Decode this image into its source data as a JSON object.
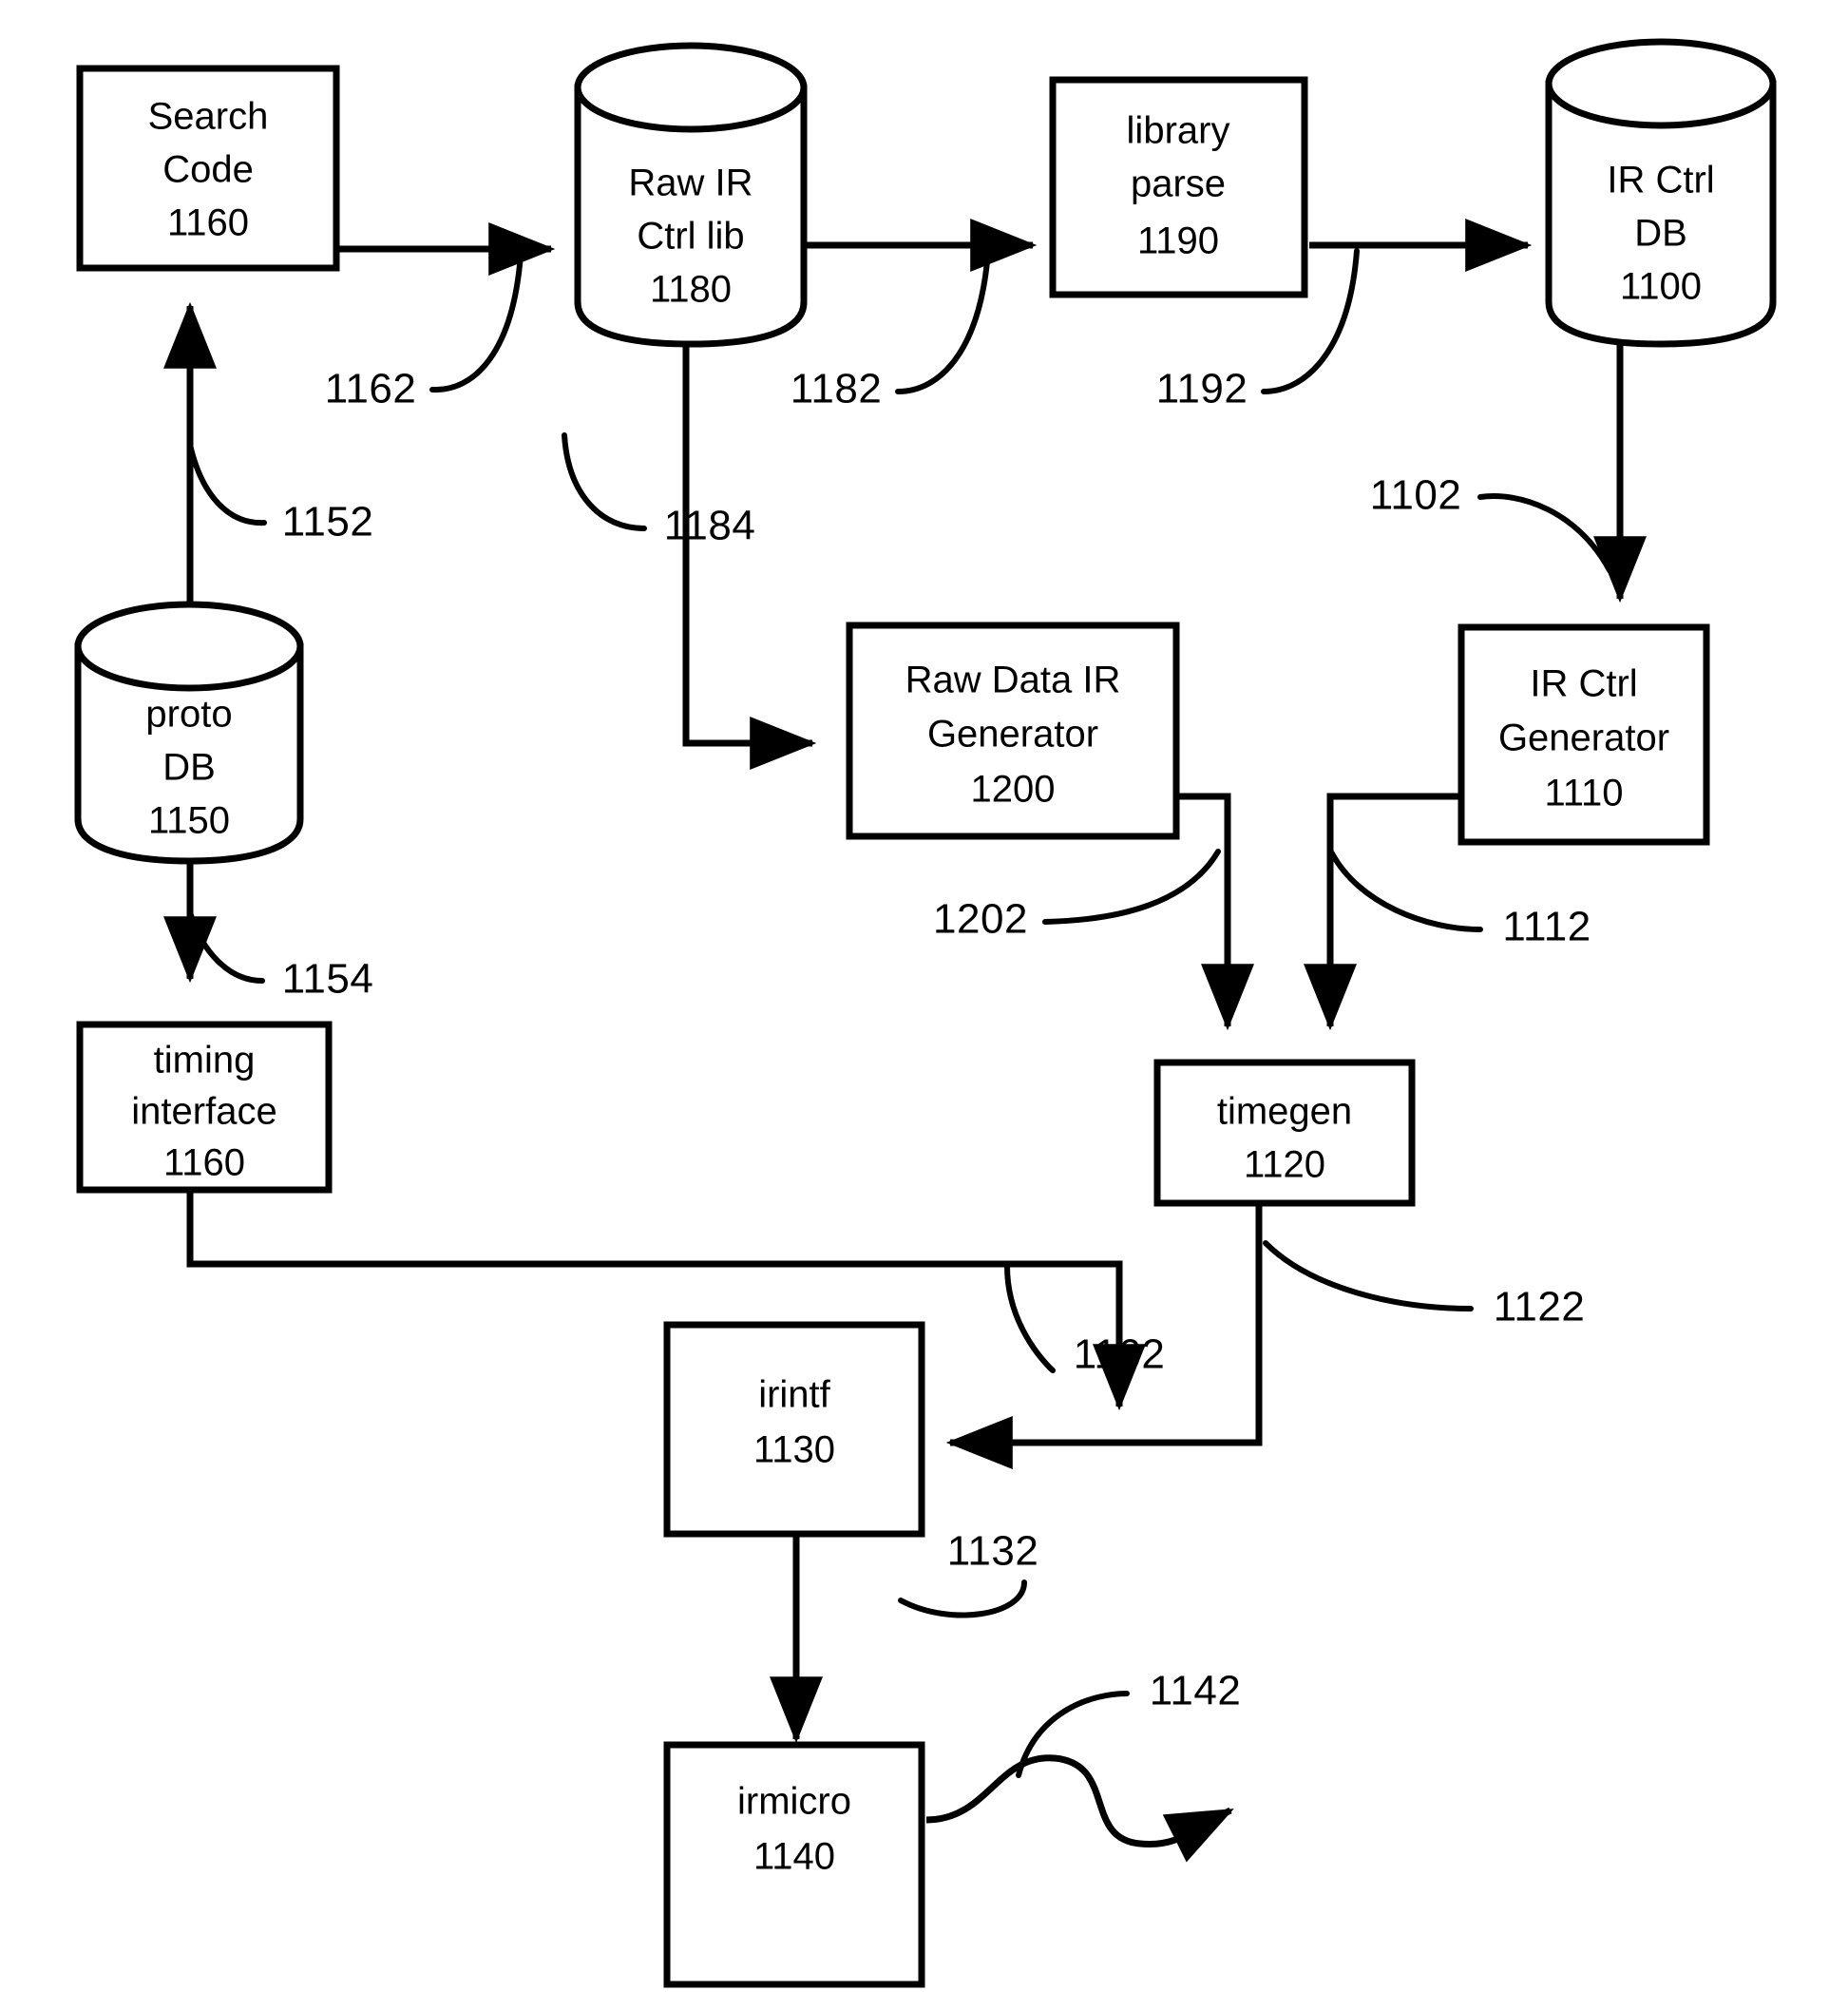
{
  "figure": {
    "type": "patent-flow-diagram",
    "background_color": "#ffffff",
    "line_color": "#000000"
  },
  "nodes": [
    {
      "id": "search_code",
      "shape": "rectangle",
      "lines": [
        "Search",
        "Code",
        "1160"
      ]
    },
    {
      "id": "raw_ir_ctrl_lib",
      "shape": "cylinder",
      "lines": [
        "Raw IR",
        "Ctrl lib",
        "1180"
      ]
    },
    {
      "id": "library_parse",
      "shape": "rectangle",
      "lines": [
        "library",
        "parse",
        "1190"
      ]
    },
    {
      "id": "ir_ctrl_db",
      "shape": "cylinder",
      "lines": [
        "IR Ctrl",
        "DB",
        "1100"
      ]
    },
    {
      "id": "proto_db",
      "shape": "cylinder",
      "lines": [
        "proto",
        "DB",
        "1150"
      ]
    },
    {
      "id": "raw_data_ir_generator",
      "shape": "rectangle",
      "lines": [
        "Raw Data IR",
        "Generator",
        "1200"
      ]
    },
    {
      "id": "ir_ctrl_generator",
      "shape": "rectangle",
      "lines": [
        "IR Ctrl",
        "Generator",
        "1110"
      ]
    },
    {
      "id": "timing_interface",
      "shape": "rectangle",
      "lines": [
        "timing",
        "interface",
        "1160"
      ]
    },
    {
      "id": "timegen",
      "shape": "rectangle",
      "lines": [
        "timegen",
        "1120"
      ]
    },
    {
      "id": "irintf",
      "shape": "rectangle",
      "lines": [
        "irintf",
        "1130"
      ]
    },
    {
      "id": "irmicro",
      "shape": "rectangle",
      "lines": [
        "irmicro",
        "1140"
      ]
    }
  ],
  "reference_labels": [
    {
      "id": "ref_1162_top",
      "text": "1162"
    },
    {
      "id": "ref_1182",
      "text": "1182"
    },
    {
      "id": "ref_1192",
      "text": "1192"
    },
    {
      "id": "ref_1152",
      "text": "1152"
    },
    {
      "id": "ref_1184",
      "text": "1184"
    },
    {
      "id": "ref_1102",
      "text": "1102"
    },
    {
      "id": "ref_1154",
      "text": "1154"
    },
    {
      "id": "ref_1202",
      "text": "1202"
    },
    {
      "id": "ref_1112",
      "text": "1112"
    },
    {
      "id": "ref_1162_mid",
      "text": "1162"
    },
    {
      "id": "ref_1122",
      "text": "1122"
    },
    {
      "id": "ref_1132",
      "text": "1132"
    },
    {
      "id": "ref_1142",
      "text": "1142"
    }
  ],
  "node_text": {
    "search_code": {
      "l1": "Search",
      "l2": "Code",
      "l3": "1160"
    },
    "raw_ir_ctrl_lib": {
      "l1": "Raw IR",
      "l2": "Ctrl lib",
      "l3": "1180"
    },
    "library_parse": {
      "l1": "library",
      "l2": "parse",
      "l3": "1190"
    },
    "ir_ctrl_db": {
      "l1": "IR Ctrl",
      "l2": "DB",
      "l3": "1100"
    },
    "proto_db": {
      "l1": "proto",
      "l2": "DB",
      "l3": "1150"
    },
    "raw_data_ir_generator": {
      "l1": "Raw Data IR",
      "l2": "Generator",
      "l3": "1200"
    },
    "ir_ctrl_generator": {
      "l1": "IR Ctrl",
      "l2": "Generator",
      "l3": "1110"
    },
    "timing_interface": {
      "l1": "timing",
      "l2": "interface",
      "l3": "1160"
    },
    "timegen": {
      "l1": "timegen",
      "l2": "1120"
    },
    "irintf": {
      "l1": "irintf",
      "l2": "1130"
    },
    "irmicro": {
      "l1": "irmicro",
      "l2": "1140"
    }
  },
  "refs": {
    "r1162a": "1162",
    "r1182": "1182",
    "r1192": "1192",
    "r1152": "1152",
    "r1184": "1184",
    "r1102": "1102",
    "r1154": "1154",
    "r1202": "1202",
    "r1112": "1112",
    "r1162b": "1162",
    "r1122": "1122",
    "r1132": "1132",
    "r1142": "1142"
  },
  "connections": [
    {
      "from": "search_code",
      "to": "raw_ir_ctrl_lib",
      "ref": "1162"
    },
    {
      "from": "raw_ir_ctrl_lib",
      "to": "library_parse",
      "ref": "1182"
    },
    {
      "from": "library_parse",
      "to": "ir_ctrl_db",
      "ref": "1192"
    },
    {
      "from": "proto_db",
      "to": "search_code",
      "ref": "1152"
    },
    {
      "from": "raw_ir_ctrl_lib",
      "to": "raw_data_ir_generator",
      "ref": "1184"
    },
    {
      "from": "ir_ctrl_db",
      "to": "ir_ctrl_generator",
      "ref": "1102"
    },
    {
      "from": "proto_db",
      "to": "timing_interface",
      "ref": "1154"
    },
    {
      "from": "raw_data_ir_generator",
      "to": "timegen",
      "ref": "1202"
    },
    {
      "from": "ir_ctrl_generator",
      "to": "timegen",
      "ref": "1112"
    },
    {
      "from": "timing_interface",
      "to": "irintf",
      "ref": "1162"
    },
    {
      "from": "timegen",
      "to": "irintf",
      "ref": "1122"
    },
    {
      "from": "irintf",
      "to": "irmicro",
      "ref": "1132"
    },
    {
      "from": "irmicro",
      "to": "output",
      "ref": "1142"
    }
  ]
}
